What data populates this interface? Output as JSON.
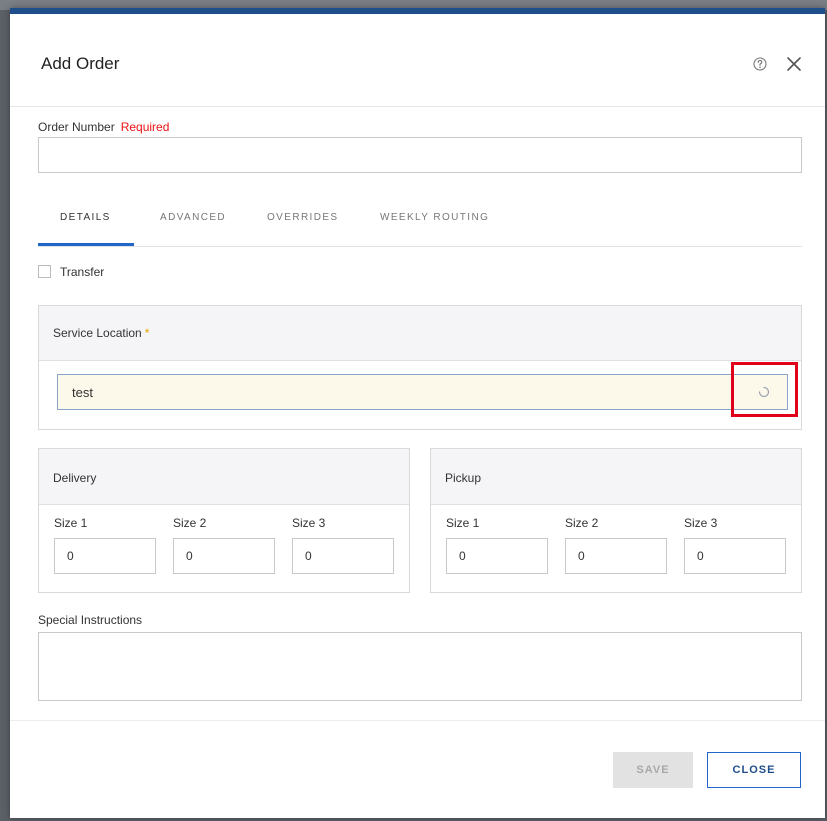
{
  "dialog": {
    "title": "Add Order",
    "help_icon": "help-circle-icon",
    "close_icon": "close-icon"
  },
  "order_number": {
    "label": "Order Number",
    "required_text": "Required",
    "value": ""
  },
  "tabs": [
    {
      "label": "DETAILS",
      "active": true
    },
    {
      "label": "ADVANCED",
      "active": false
    },
    {
      "label": "OVERRIDES",
      "active": false
    },
    {
      "label": "WEEKLY ROUTING",
      "active": false
    }
  ],
  "transfer": {
    "label": "Transfer",
    "checked": false
  },
  "service_location": {
    "title": "Service Location",
    "required_mark": "*",
    "value": "test",
    "loading_icon": "spinner-icon"
  },
  "delivery": {
    "title": "Delivery",
    "sizes": [
      {
        "label": "Size 1",
        "value": "0"
      },
      {
        "label": "Size 2",
        "value": "0"
      },
      {
        "label": "Size 3",
        "value": "0"
      }
    ]
  },
  "pickup": {
    "title": "Pickup",
    "sizes": [
      {
        "label": "Size 1",
        "value": "0"
      },
      {
        "label": "Size 2",
        "value": "0"
      },
      {
        "label": "Size 3",
        "value": "0"
      }
    ]
  },
  "special_instructions": {
    "label": "Special Instructions",
    "value": ""
  },
  "footer": {
    "save_label": "SAVE",
    "close_label": "CLOSE"
  },
  "colors": {
    "accent": "#1f66c7",
    "header_bar": "#1f4e8c",
    "required_red": "#e11111",
    "asterisk_gold": "#e8a400",
    "input_highlight_bg": "#fdf9ea",
    "annotation_red": "#e0001a"
  }
}
